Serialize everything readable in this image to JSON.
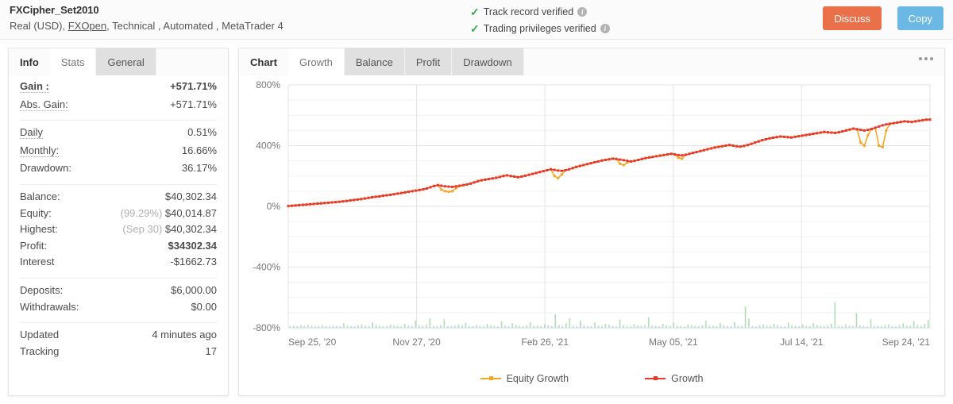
{
  "header": {
    "account_name": "FXCipher_Set2010",
    "subtitle_prefix": "Real (USD),",
    "broker_link": "FXOpen",
    "subtitle_suffix": ", Technical , Automated , MetaTrader 4",
    "verifications": [
      {
        "label": "Track record verified",
        "icon": "check-icon",
        "info": "i"
      },
      {
        "label": "Trading privileges verified",
        "icon": "check-icon",
        "info": "i"
      }
    ],
    "discuss_label": "Discuss",
    "copy_label": "Copy",
    "discuss_color": "#ea7049",
    "copy_color": "#6cb8e4",
    "check_color": "#37a64a"
  },
  "stats_panel": {
    "tabs": [
      {
        "label": "Info",
        "state": "label"
      },
      {
        "label": "Stats",
        "state": "active"
      },
      {
        "label": "General",
        "state": "inactive"
      }
    ],
    "groups": [
      {
        "rows": [
          {
            "label": "Gain :",
            "value": "+571.71%",
            "label_style": "dotted-bold",
            "value_style": "green-bold"
          },
          {
            "label": "Abs. Gain:",
            "value": "+571.71%",
            "label_style": "dotted",
            "value_style": "green"
          }
        ]
      },
      {
        "rows": [
          {
            "label": "Daily",
            "value": "0.51%",
            "label_style": "dotted",
            "value_style": "plain"
          },
          {
            "label": "Monthly:",
            "value": "16.66%",
            "label_style": "dotted",
            "value_style": "plain"
          },
          {
            "label": "Drawdown:",
            "value": "36.17%",
            "label_style": "plain",
            "value_style": "plain"
          }
        ]
      },
      {
        "rows": [
          {
            "label": "Balance:",
            "value": "$40,302.34",
            "label_style": "plain",
            "value_style": "plain"
          },
          {
            "label": "Equity:",
            "prefix": "(99.29%)",
            "value": "$40,014.87",
            "label_style": "plain",
            "value_style": "plain"
          },
          {
            "label": "Highest:",
            "prefix": "(Sep 30)",
            "value": "$40,302.34",
            "label_style": "plain",
            "value_style": "plain"
          },
          {
            "label": "Profit:",
            "value": "$34302.34",
            "label_style": "plain",
            "value_style": "green-bold"
          },
          {
            "label": "Interest",
            "value": "-$1662.73",
            "label_style": "plain",
            "value_style": "plain"
          }
        ]
      },
      {
        "rows": [
          {
            "label": "Deposits:",
            "value": "$6,000.00",
            "label_style": "plain",
            "value_style": "plain"
          },
          {
            "label": "Withdrawals:",
            "value": "$0.00",
            "label_style": "plain",
            "value_style": "plain"
          }
        ]
      },
      {
        "rows": [
          {
            "label": "Updated",
            "value": "4 minutes ago",
            "label_style": "plain",
            "value_style": "plain"
          },
          {
            "label": "Tracking",
            "value": "17",
            "label_style": "plain",
            "value_style": "plain"
          }
        ]
      }
    ]
  },
  "chart_panel": {
    "tabs": [
      {
        "label": "Chart",
        "state": "label"
      },
      {
        "label": "Growth",
        "state": "active"
      },
      {
        "label": "Balance",
        "state": "inactive"
      },
      {
        "label": "Profit",
        "state": "inactive"
      },
      {
        "label": "Drawdown",
        "state": "inactive"
      }
    ],
    "menu_icon": "more-options-icon"
  },
  "chart_data": {
    "type": "line",
    "title": "",
    "xlabel": "",
    "ylabel": "",
    "ylim": [
      -800,
      800
    ],
    "ytick_labels": [
      "800%",
      "400%",
      "0%",
      "-400%",
      "-800%"
    ],
    "yticks": [
      800,
      400,
      0,
      -400,
      -800
    ],
    "minor_tick_step": 100,
    "grid": true,
    "legend_position": "bottom-center",
    "xtick_labels": [
      "Sep 25, '20",
      "Nov 27, '20",
      "Feb 26, '21",
      "May 05, '21",
      "Jul 14, '21",
      "Sep 24, '21"
    ],
    "xticks": [
      0,
      0.2,
      0.4,
      0.6,
      0.8,
      1.0
    ],
    "series": [
      {
        "name": "Growth",
        "color": "#e8392a",
        "marker": "square",
        "values": [
          2,
          4,
          6,
          8,
          10,
          12,
          14,
          16,
          18,
          20,
          22,
          24,
          26,
          28,
          30,
          33,
          36,
          39,
          42,
          45,
          48,
          52,
          56,
          60,
          63,
          66,
          70,
          73,
          76,
          80,
          84,
          88,
          92,
          96,
          100,
          104,
          108,
          112,
          118,
          126,
          134,
          140,
          136,
          132,
          130,
          128,
          132,
          136,
          140,
          144,
          150,
          158,
          166,
          172,
          176,
          180,
          184,
          188,
          194,
          200,
          204,
          200,
          196,
          192,
          196,
          202,
          208,
          214,
          220,
          226,
          232,
          238,
          244,
          240,
          236,
          234,
          238,
          244,
          252,
          260,
          266,
          272,
          278,
          284,
          290,
          296,
          302,
          306,
          310,
          314,
          312,
          308,
          304,
          300,
          296,
          300,
          306,
          312,
          318,
          322,
          326,
          330,
          334,
          338,
          342,
          346,
          342,
          338,
          336,
          340,
          346,
          352,
          358,
          364,
          370,
          376,
          382,
          388,
          392,
          396,
          400,
          404,
          400,
          396,
          394,
          398,
          404,
          412,
          420,
          428,
          436,
          442,
          448,
          452,
          456,
          460,
          458,
          456,
          454,
          458,
          462,
          466,
          470,
          474,
          478,
          482,
          486,
          490,
          488,
          486,
          484,
          488,
          494,
          500,
          506,
          512,
          508,
          504,
          500,
          504,
          510,
          518,
          526,
          534,
          540,
          544,
          548,
          552,
          556,
          560,
          558,
          556,
          560,
          564,
          568,
          571,
          571.71
        ]
      },
      {
        "name": "Equity Growth",
        "color": "#f5a623",
        "marker": "square",
        "values": [
          2,
          4,
          6,
          8,
          10,
          12,
          14,
          16,
          18,
          20,
          22,
          24,
          26,
          28,
          30,
          33,
          36,
          39,
          42,
          45,
          48,
          52,
          56,
          60,
          63,
          66,
          70,
          73,
          76,
          80,
          84,
          88,
          92,
          96,
          100,
          104,
          108,
          112,
          118,
          126,
          134,
          140,
          110,
          100,
          96,
          100,
          120,
          134,
          140,
          144,
          150,
          158,
          166,
          172,
          176,
          180,
          184,
          188,
          194,
          200,
          204,
          200,
          196,
          192,
          196,
          202,
          208,
          214,
          220,
          226,
          232,
          238,
          244,
          200,
          186,
          210,
          238,
          244,
          252,
          260,
          266,
          272,
          278,
          284,
          290,
          296,
          302,
          306,
          310,
          314,
          312,
          280,
          272,
          290,
          296,
          300,
          306,
          312,
          318,
          322,
          326,
          330,
          334,
          338,
          342,
          346,
          342,
          320,
          314,
          340,
          346,
          352,
          358,
          364,
          370,
          376,
          382,
          388,
          392,
          396,
          400,
          404,
          400,
          396,
          394,
          398,
          404,
          412,
          420,
          428,
          436,
          442,
          448,
          452,
          456,
          460,
          458,
          456,
          454,
          458,
          462,
          466,
          470,
          474,
          478,
          482,
          486,
          490,
          488,
          486,
          484,
          488,
          494,
          500,
          506,
          512,
          508,
          420,
          400,
          470,
          510,
          518,
          400,
          390,
          500,
          544,
          548,
          552,
          556,
          560,
          558,
          556,
          560,
          564,
          568,
          571,
          571.71
        ]
      }
    ],
    "bars": {
      "name": "Drawdown bars",
      "color": "#a5d6a7",
      "baseline": -800,
      "values": [
        12,
        14,
        10,
        16,
        12,
        20,
        14,
        10,
        12,
        18,
        12,
        10,
        14,
        12,
        10,
        30,
        14,
        12,
        10,
        16,
        22,
        14,
        12,
        34,
        18,
        12,
        10,
        14,
        22,
        16,
        12,
        10,
        26,
        14,
        12,
        48,
        16,
        12,
        20,
        62,
        14,
        12,
        18,
        56,
        12,
        10,
        14,
        22,
        16,
        34,
        12,
        10,
        18,
        14,
        12,
        26,
        16,
        12,
        10,
        42,
        14,
        12,
        30,
        18,
        12,
        10,
        16,
        38,
        14,
        12,
        10,
        22,
        16,
        12,
        90,
        18,
        12,
        30,
        62,
        14,
        12,
        48,
        16,
        12,
        10,
        34,
        14,
        12,
        26,
        18,
        12,
        10,
        54,
        16,
        12,
        10,
        22,
        14,
        12,
        18,
        70,
        14,
        12,
        10,
        26,
        16,
        12,
        34,
        14,
        12,
        10,
        22,
        18,
        12,
        10,
        16,
        46,
        14,
        12,
        10,
        30,
        16,
        12,
        10,
        38,
        14,
        12,
        140,
        60,
        12,
        10,
        16,
        22,
        14,
        12,
        26,
        18,
        12,
        10,
        34,
        16,
        12,
        10,
        22,
        14,
        12,
        30,
        18,
        12,
        10,
        16,
        26,
        170,
        12,
        10,
        22,
        14,
        12,
        98,
        16,
        12,
        10,
        56,
        14,
        12,
        10,
        18,
        22,
        12,
        10,
        16,
        30,
        14,
        12,
        44,
        18,
        12,
        26,
        52
      ]
    }
  }
}
